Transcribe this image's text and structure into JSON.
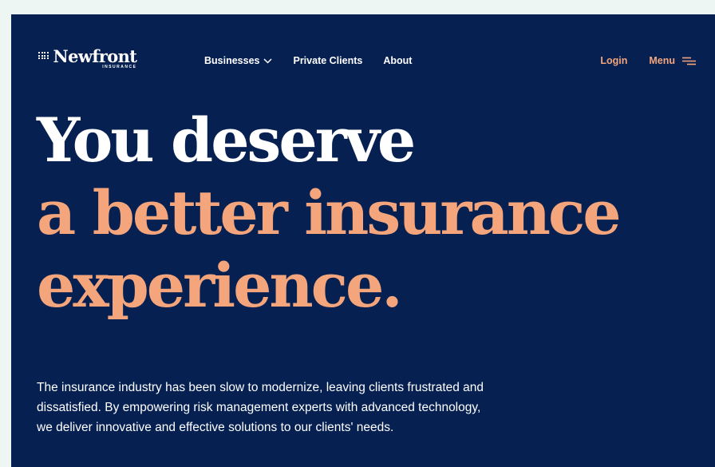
{
  "header": {
    "logo": {
      "word": "Newfront",
      "sub": "INSURANCE"
    },
    "nav": [
      {
        "label": "Businesses",
        "icon": "chevron-down-icon"
      },
      {
        "label": "Private Clients"
      },
      {
        "label": "About"
      }
    ],
    "login_label": "Login",
    "menu_label": "Menu",
    "menu_icon": "hamburger-icon"
  },
  "hero": {
    "line1": "You deserve",
    "line2": "a better insurance",
    "line3": "experience."
  },
  "description": "The insurance industry has been slow to modernize, leaving clients frustrated and dissatisfied. By empowering risk management experts with advanced technology, we deliver innovative and effective solutions to our clients' needs.",
  "colors": {
    "background": "#062052",
    "accent": "#f4a57c",
    "text": "#ffffff",
    "page": "#eef6f3"
  }
}
